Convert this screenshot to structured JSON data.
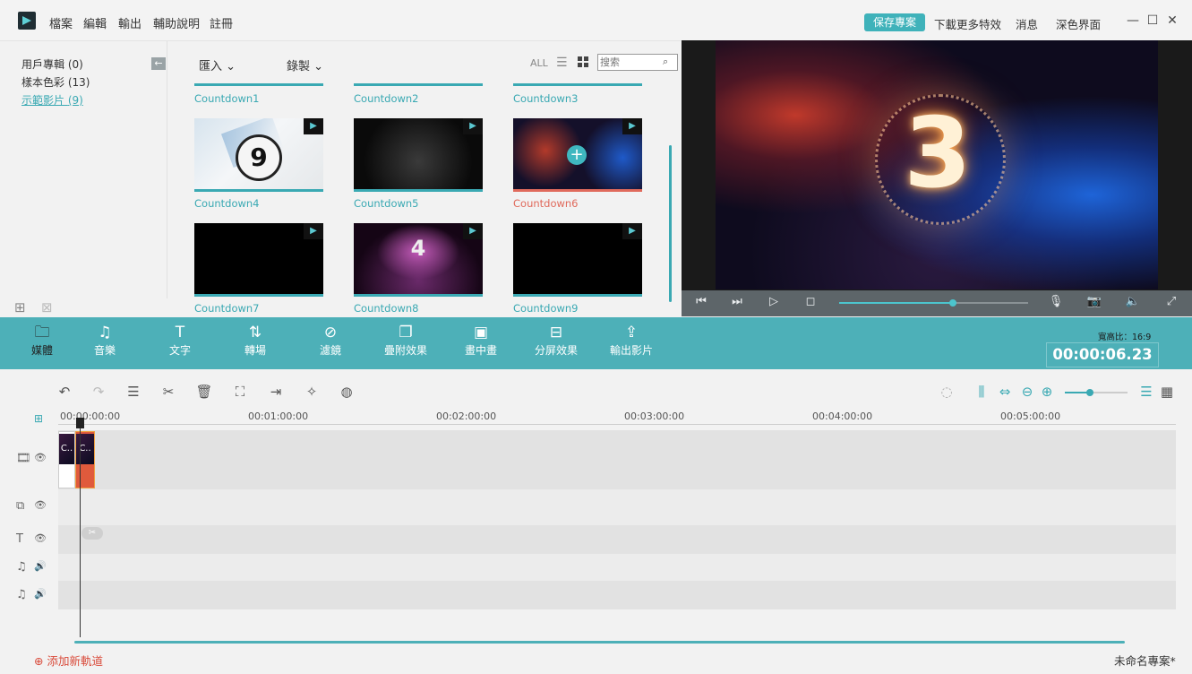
{
  "menu": {
    "items": [
      "檔案",
      "編輯",
      "輸出",
      "輔助說明",
      "註冊"
    ]
  },
  "title_right": {
    "save": "保存專案",
    "more_effects": "下載更多特效",
    "messages": "消息",
    "dark_ui": "深色界面"
  },
  "window_controls": {
    "minimize": "—",
    "maximize": "☐",
    "close": "✕"
  },
  "tree": {
    "items": [
      {
        "label": "用戶專輯",
        "count": "(0)"
      },
      {
        "label": "樣本色彩",
        "count": "(13)"
      },
      {
        "label": "示範影片",
        "count": "(9)"
      }
    ]
  },
  "library": {
    "import": "匯入",
    "record": "錄製",
    "all": "ALL",
    "search_placeholder": "搜索",
    "row0": [
      "Countdown1",
      "Countdown2",
      "Countdown3"
    ],
    "clips": [
      {
        "label": "Countdown4",
        "thumb": "9"
      },
      {
        "label": "Countdown5",
        "thumb": ""
      },
      {
        "label": "Countdown6",
        "thumb": "+"
      },
      {
        "label": "Countdown7",
        "thumb": ""
      },
      {
        "label": "Countdown8",
        "thumb": "4"
      },
      {
        "label": "Countdown9",
        "thumb": ""
      }
    ]
  },
  "preview": {
    "number": "3",
    "progress": 0.6
  },
  "tabs": [
    {
      "label": "媒體",
      "icon": "folder-icon"
    },
    {
      "label": "音樂",
      "icon": "music-icon"
    },
    {
      "label": "文字",
      "icon": "text-icon"
    },
    {
      "label": "轉場",
      "icon": "transition-icon"
    },
    {
      "label": "濾鏡",
      "icon": "filter-icon"
    },
    {
      "label": "疊附效果",
      "icon": "overlay-icon"
    },
    {
      "label": "畫中畫",
      "icon": "pip-icon"
    },
    {
      "label": "分屏效果",
      "icon": "split-screen-icon"
    },
    {
      "label": "輸出影片",
      "icon": "export-icon"
    }
  ],
  "ratio": {
    "label": "寬高比：",
    "value": "16:9"
  },
  "timecode": "00:00:06.23",
  "timeline": {
    "ticks": [
      "00:00:00:00",
      "00:01:00:00",
      "00:02:00:00",
      "00:03:00:00",
      "00:04:00:00",
      "00:05:00:00"
    ],
    "clips": [
      "C..",
      "C.."
    ],
    "zoom": 0.4
  },
  "footer": {
    "add_track": "添加新軌道",
    "project_name": "未命名專案*"
  }
}
